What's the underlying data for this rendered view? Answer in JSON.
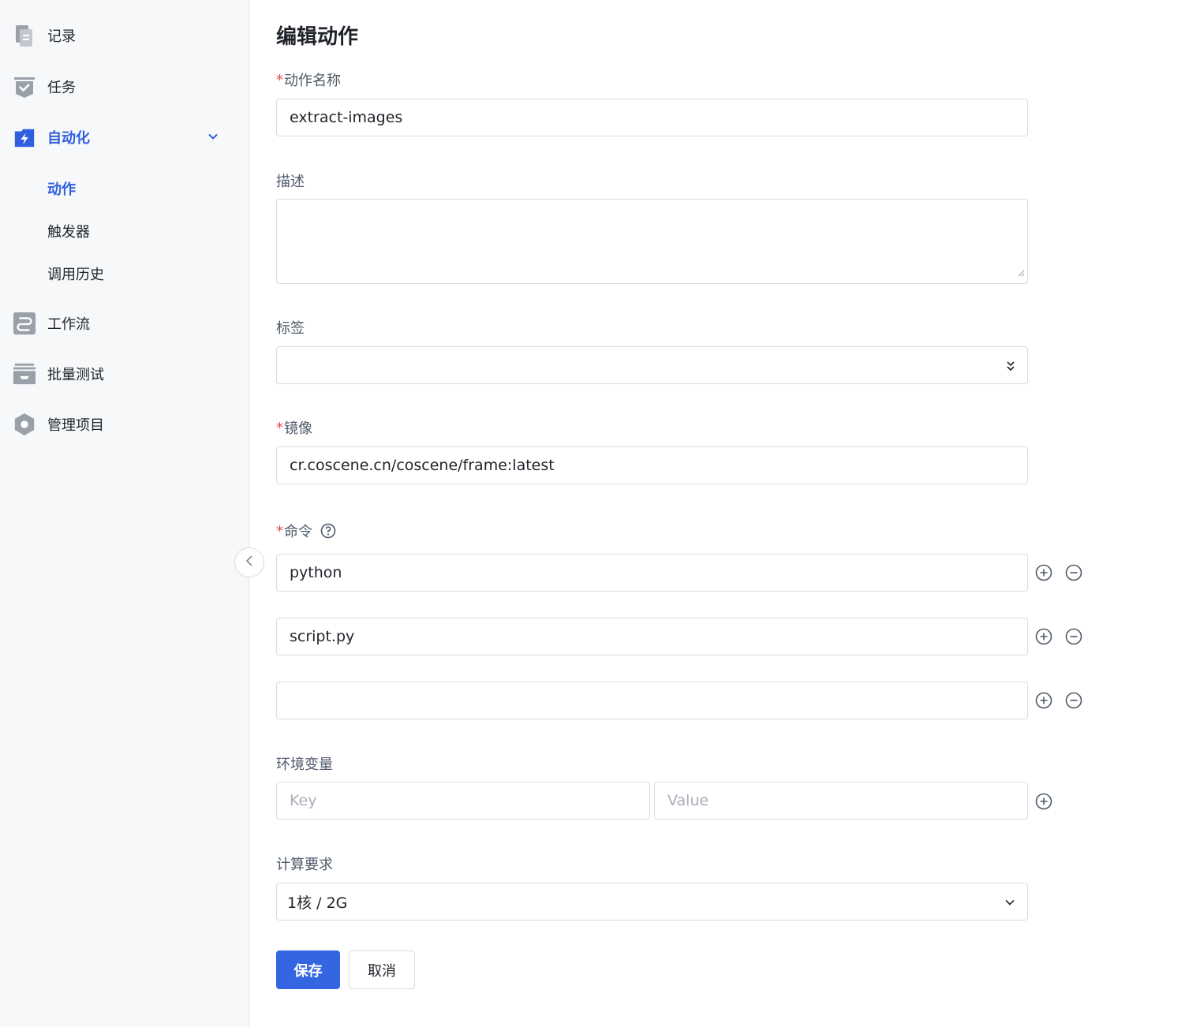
{
  "sidebar": {
    "items": [
      {
        "label": "记录",
        "icon": "records-icon"
      },
      {
        "label": "任务",
        "icon": "task-icon"
      },
      {
        "label": "自动化",
        "icon": "automation-icon"
      },
      {
        "label": "工作流",
        "icon": "workflow-icon"
      },
      {
        "label": "批量测试",
        "icon": "batch-test-icon"
      },
      {
        "label": "管理项目",
        "icon": "manage-project-icon"
      }
    ],
    "sub_items": [
      "动作",
      "触发器",
      "调用历史"
    ],
    "active_color": "#2f5fdc"
  },
  "form": {
    "title": "编辑动作",
    "name_label": "动作名称",
    "name_value": "extract-images",
    "desc_label": "描述",
    "desc_value": "",
    "tags_label": "标签",
    "image_label": "镜像",
    "image_value": "cr.coscene.cn/coscene/frame:latest",
    "command_label": "命令",
    "commands": [
      "python",
      "script.py",
      ""
    ],
    "env_label": "环境变量",
    "env_key_placeholder": "Key",
    "env_value_placeholder": "Value",
    "compute_label": "计算要求",
    "compute_value": "1核 / 2G",
    "save_label": "保存",
    "cancel_label": "取消",
    "required_mark": "*"
  }
}
